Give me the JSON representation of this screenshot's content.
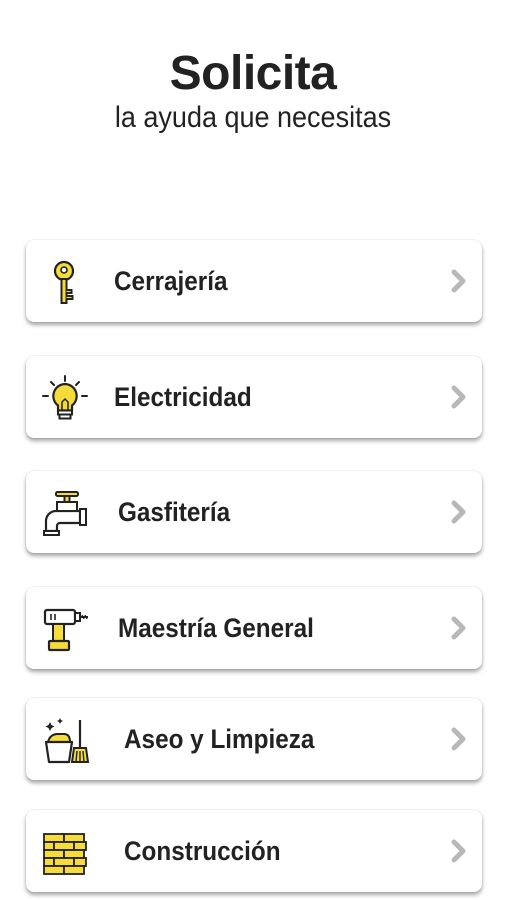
{
  "header": {
    "title": "Solicita",
    "subtitle": "la ayuda que necesitas"
  },
  "services": [
    {
      "label": "Cerrajería",
      "icon": "key-icon"
    },
    {
      "label": "Electricidad",
      "icon": "lightbulb-icon"
    },
    {
      "label": "Gasfitería",
      "icon": "faucet-icon"
    },
    {
      "label": "Maestría General",
      "icon": "drill-icon"
    },
    {
      "label": "Aseo y Limpieza",
      "icon": "cleaning-supplies-icon"
    },
    {
      "label": "Construcción",
      "icon": "brick-wall-icon"
    }
  ],
  "colors": {
    "accent": "#f5dc3a",
    "text": "#222222",
    "chevron": "#b8b8b8"
  }
}
